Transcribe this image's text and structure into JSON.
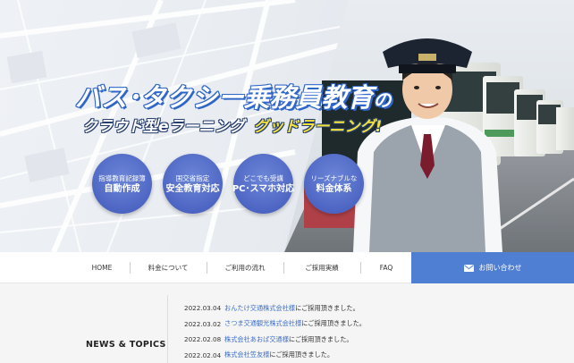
{
  "hero": {
    "headline": "バス･タクシー乗務員教育",
    "headline_suffix": "の",
    "sub_a": "クラウド型eラーニング",
    "sub_b": "グッドラーニング!",
    "features": [
      {
        "line1": "指導教育記録簿",
        "line2": "自動作成"
      },
      {
        "line1": "国交省指定",
        "line2": "安全教育対応"
      },
      {
        "line1": "どこでも受講",
        "line2": "PC･スマホ対応"
      },
      {
        "line1": "リーズナブルな",
        "line2": "料金体系"
      }
    ]
  },
  "nav": {
    "items": [
      "HOME",
      "料金について",
      "ご利用の流れ",
      "ご採用実績",
      "FAQ"
    ],
    "contact_label": "お問い合わせ"
  },
  "news": {
    "heading": "NEWS & TOPICS",
    "items": [
      {
        "date": "2022.03.04",
        "company": "おんたけ交通株式会社様",
        "text": "にご採用頂きました。"
      },
      {
        "date": "2022.03.02",
        "company": "さつま交通観光株式会社様",
        "text": "にご採用頂きました。"
      },
      {
        "date": "2022.02.08",
        "company": "株式会社あおば交通様",
        "text": "にご採用頂きました。"
      },
      {
        "date": "2022.02.04",
        "company": "株式会社笠友様",
        "text": "にご採用頂きました。"
      }
    ]
  },
  "colors": {
    "accent": "#4f7fd3",
    "circle": "#4e66c3",
    "link": "#3c6ec8",
    "headline_stroke": "#2f66c9",
    "highlight": "#f3e23a"
  },
  "icons": {
    "contact": "mail-icon"
  }
}
